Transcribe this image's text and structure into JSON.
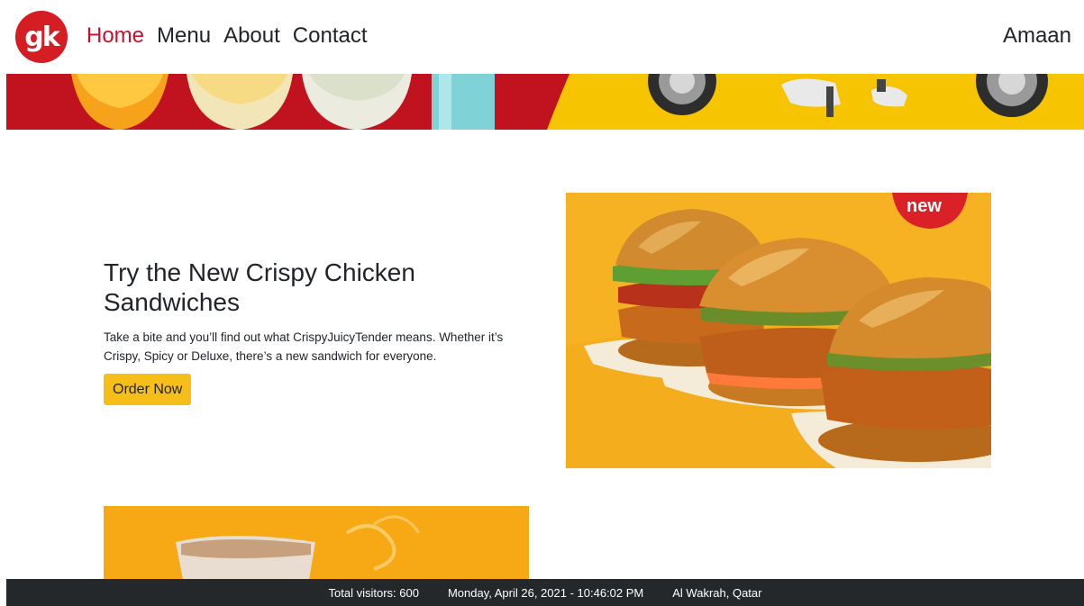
{
  "header": {
    "logo_text": "gk",
    "nav": [
      {
        "label": "Home",
        "active": true
      },
      {
        "label": "Menu",
        "active": false
      },
      {
        "label": "About",
        "active": false
      },
      {
        "label": "Contact",
        "active": false
      }
    ],
    "user_name": "Amaan"
  },
  "promo": {
    "title": "Try the New Crispy Chicken Sandwiches",
    "description": "Take a bite and you’ll find out what CrispyJuicyTender means. Whether it’s Crispy, Spicy or Deluxe, there’s a new sandwich for everyone.",
    "button_label": "Order Now",
    "badge": "new"
  },
  "footer": {
    "visitors": "Total visitors: 600",
    "datetime": "Monday, April 26, 2021 - 10:46:02 PM",
    "location": "Al Wakrah, Qatar"
  },
  "colors": {
    "brand_red": "#d51d24",
    "active_link": "#c8102e",
    "button_yellow": "#f5be19",
    "footer_bg": "#25282b"
  }
}
